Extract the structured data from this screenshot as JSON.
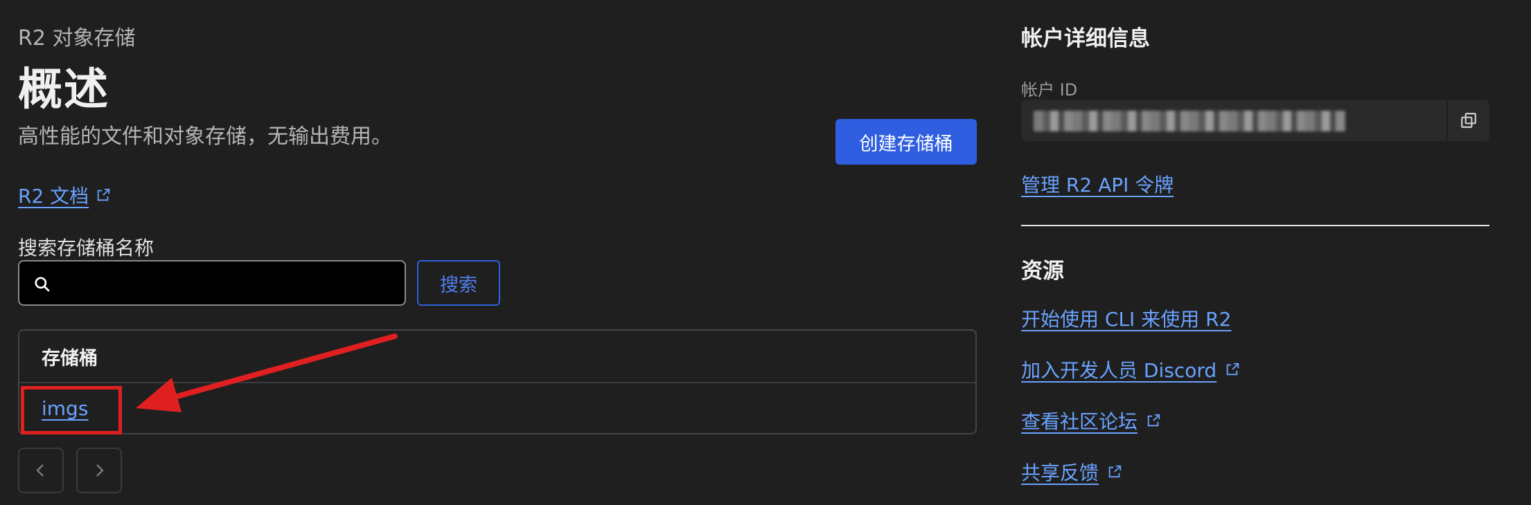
{
  "header": {
    "breadcrumb": "R2 对象存储",
    "title": "概述",
    "subtitle": "高性能的文件和对象存储，无输出费用。"
  },
  "actions": {
    "create_bucket": "创建存储桶"
  },
  "docs_link": "R2 文档",
  "search": {
    "label": "搜索存储桶名称",
    "value": "",
    "placeholder": "",
    "button": "搜索"
  },
  "table": {
    "header": "存储桶",
    "rows": [
      "imgs"
    ]
  },
  "pager": {
    "prev": "‹",
    "next": "›"
  },
  "account": {
    "title": "帐户详细信息",
    "id_label": "帐户 ID",
    "manage_api_tokens": "管理 R2 API 令牌"
  },
  "resources": {
    "title": "资源",
    "links": [
      "开始使用 CLI 来使用 R2",
      "加入开发人员 Discord",
      "查看社区论坛",
      "共享反馈"
    ]
  },
  "colors": {
    "background": "#1f1f1f",
    "primary": "#2f5fe0",
    "link": "#6aa2ff",
    "annotation": "#e02020"
  },
  "icons": {
    "search": "search-icon",
    "external": "external-link-icon",
    "copy": "copy-icon",
    "prev": "chevron-left-icon",
    "next": "chevron-right-icon"
  }
}
